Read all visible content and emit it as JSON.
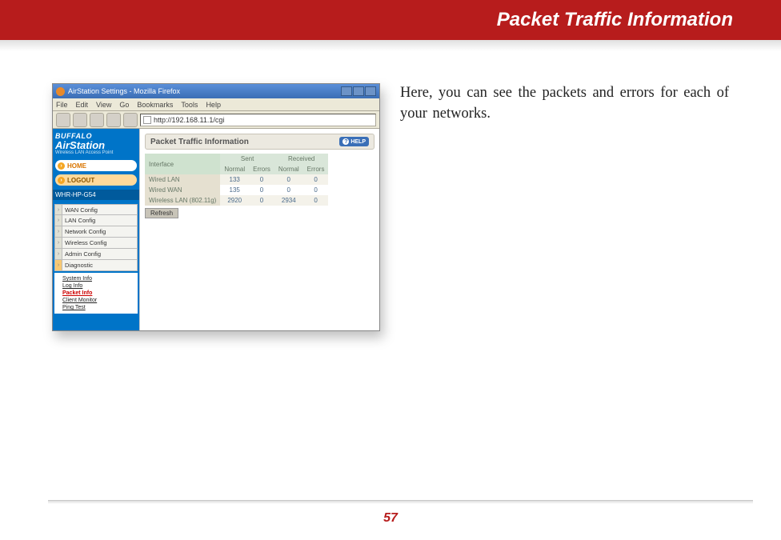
{
  "header": {
    "title": "Packet Traffic Information"
  },
  "description": "Here, you can see the packets and errors for each of your networks.",
  "page_number": "57",
  "browser": {
    "window_title": "AirStation Settings - Mozilla Firefox",
    "menu": {
      "file": "File",
      "edit": "Edit",
      "view": "View",
      "go": "Go",
      "bookmarks": "Bookmarks",
      "tools": "Tools",
      "help": "Help"
    },
    "address": "http://192.168.11.1/cgi"
  },
  "sidebar": {
    "brand_top": "BUFFALO",
    "brand_main": "AirStation",
    "brand_sub": "Wireless LAN Access Point",
    "home": "HOME",
    "logout": "LOGOUT",
    "model": "WHR-HP-G54",
    "config_items": {
      "wan": "WAN Config",
      "lan": "LAN Config",
      "network": "Network Config",
      "wireless": "Wireless Config",
      "admin": "Admin Config",
      "diagnostic": "Diagnostic"
    },
    "sub_items": {
      "system": "System Info",
      "log": "Log Info",
      "packet": "Packet Info",
      "client": "Client Monitor",
      "ping": "Ping Test"
    }
  },
  "panel": {
    "title": "Packet Traffic Information",
    "help": "HELP",
    "cols": {
      "interface": "Interface",
      "sent": "Sent",
      "received": "Received",
      "normal": "Normal",
      "errors": "Errors"
    },
    "rows": {
      "r0": {
        "iface": "Wired LAN",
        "sn": "133",
        "se": "0",
        "rn": "0",
        "re": "0"
      },
      "r1": {
        "iface": "Wired WAN",
        "sn": "135",
        "se": "0",
        "rn": "0",
        "re": "0"
      },
      "r2": {
        "iface": "Wireless LAN (802.11g)",
        "sn": "2920",
        "se": "0",
        "rn": "2934",
        "re": "0"
      }
    },
    "refresh": "Refresh"
  }
}
